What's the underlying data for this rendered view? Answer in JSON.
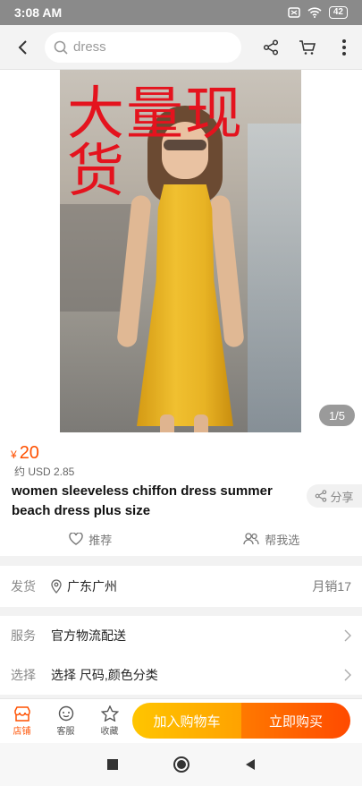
{
  "status_bar": {
    "time": "3:08 AM",
    "battery": "42"
  },
  "search": {
    "placeholder": "dress"
  },
  "hero": {
    "stamp_text": "大量现货",
    "pager": "1/5"
  },
  "product": {
    "currency": "¥",
    "price": "20",
    "usd_price": "约 USD 2.85",
    "title": "women sleeveless chiffon dress summer beach dress plus size",
    "share_label": "分享",
    "recommend_label": "推荐",
    "help_choose_label": "帮我选"
  },
  "shipping": {
    "label": "发货",
    "location": "广东广州",
    "monthly_sales": "月销17"
  },
  "service": {
    "label": "服务",
    "value": "官方物流配送"
  },
  "select": {
    "label": "选择",
    "value": "选择 尺码,颜色分类"
  },
  "bottom_bar": {
    "store_label": "店铺",
    "service_label": "客服",
    "favorite_label": "收藏",
    "add_to_cart_label": "加入购物车",
    "buy_now_label": "立即购买"
  },
  "colors": {
    "accent": "#ff5000",
    "cart": "#ffb300",
    "buy": "#ff5a00"
  }
}
